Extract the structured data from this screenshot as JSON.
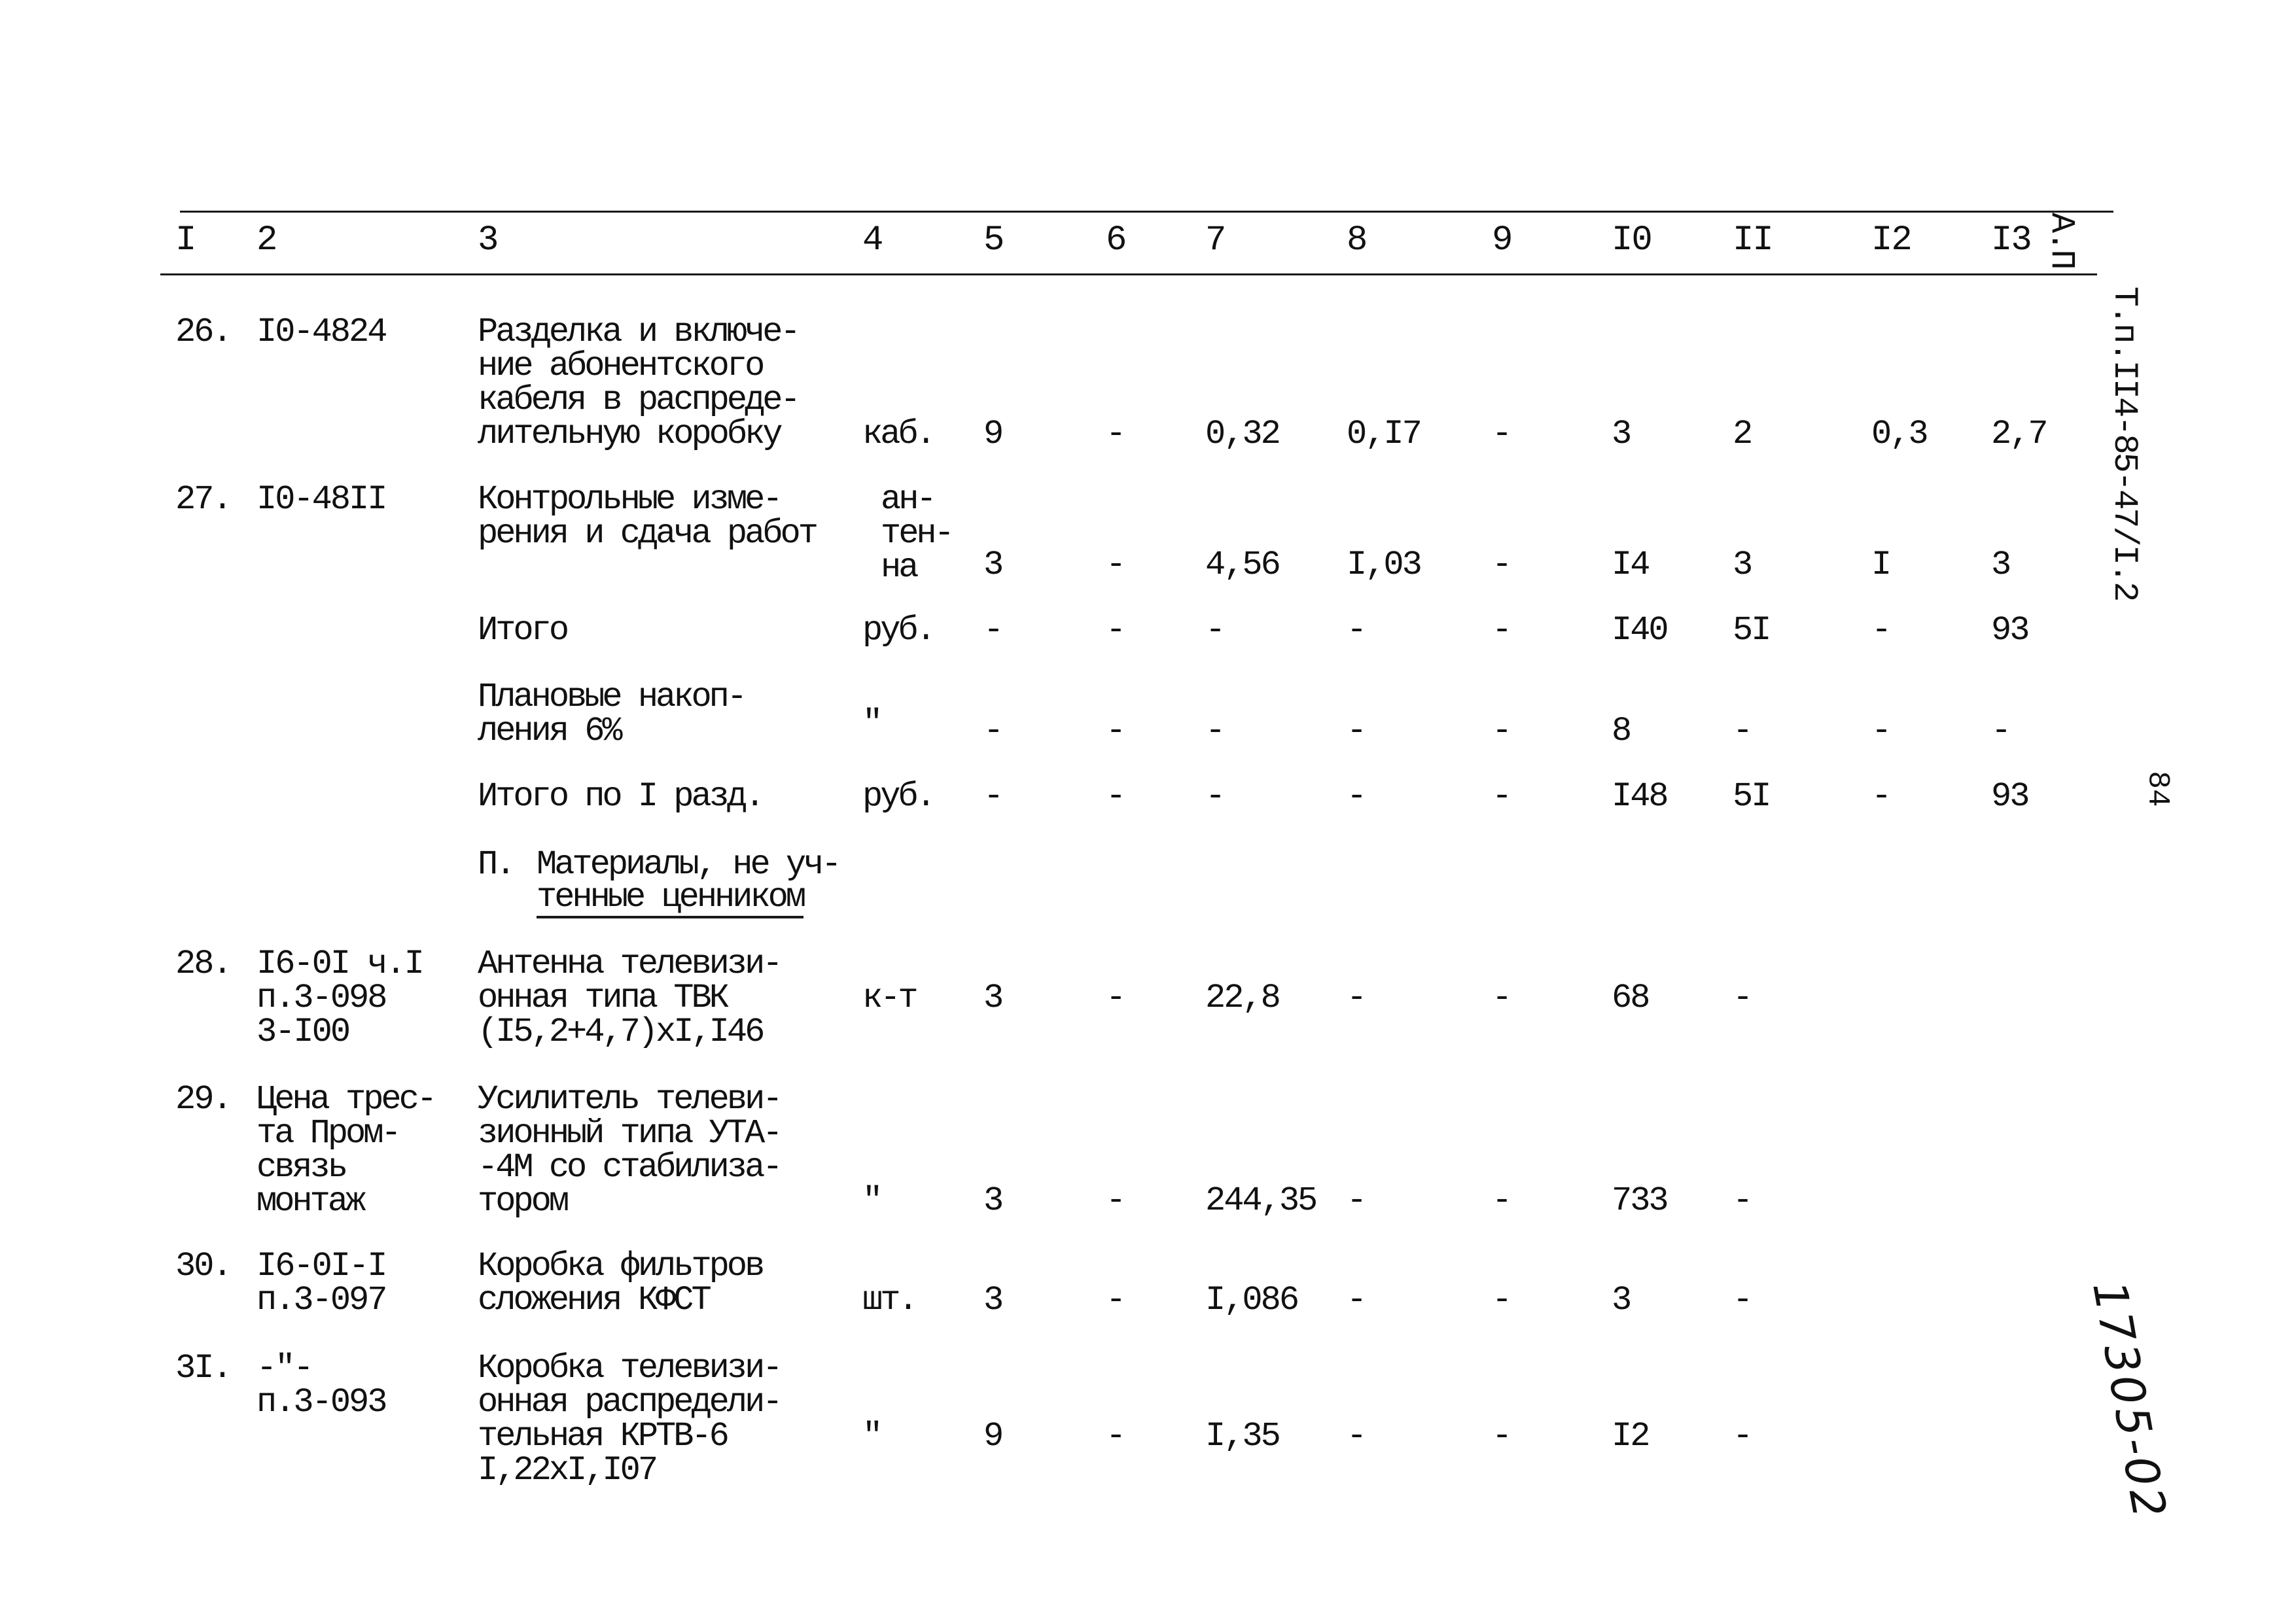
{
  "side_stamp": {
    "line1": "Т.п.II4-85-47/I.2",
    "line2": "А.П"
  },
  "page_number": "84",
  "handwritten_note": "17305-02",
  "header": [
    "I",
    "2",
    "3",
    "4",
    "5",
    "6",
    "7",
    "8",
    "9",
    "I0",
    "II",
    "I2",
    "I3"
  ],
  "rows": [
    {
      "c1": "26.",
      "c2": "I0-4824",
      "c3": "Разделка и включе-\nние абонентского\nкабеля в распреде-\nлительную коробку",
      "c4": "каб.",
      "c5": "9",
      "c6": "-",
      "c7": "0,32",
      "c8": "0,I7",
      "c9": "-",
      "c10": "3",
      "c11": "2",
      "c12": "0,3",
      "c13": "2,7"
    },
    {
      "c1": "27.",
      "c2": "I0-48II",
      "c3": "Контрольные изме-\nрения и сдача работ",
      "c4": "ан-\nтен-\nна",
      "c5": "3",
      "c6": "-",
      "c7": "4,56",
      "c8": "I,03",
      "c9": "-",
      "c10": "I4",
      "c11": "3",
      "c12": "I",
      "c13": "3"
    },
    {
      "c3": "Итого",
      "c4": "руб.",
      "c5": "-",
      "c6": "-",
      "c7": "-",
      "c8": "-",
      "c9": "-",
      "c10": "I40",
      "c11": "5I",
      "c12": "-",
      "c13": "93"
    },
    {
      "c3": "Плановые накоп-\nления 6%",
      "c4": "\"",
      "c5": "-",
      "c6": "-",
      "c7": "-",
      "c8": "-",
      "c9": "-",
      "c10": "8",
      "c11": "-",
      "c12": "-",
      "c13": "-"
    },
    {
      "c3": "Итого по I разд.",
      "c4": "руб.",
      "c5": "-",
      "c6": "-",
      "c7": "-",
      "c8": "-",
      "c9": "-",
      "c10": "I48",
      "c11": "5I",
      "c12": "-",
      "c13": "93"
    },
    {
      "section_prefix": "П. ",
      "section_line1": "Материалы, не уч-",
      "section_line2": "тенные ценником"
    },
    {
      "c1": "28.",
      "c2": "I6-0I ч.I\nп.3-098\n3-I00",
      "c3": "Антенна телевизи-\nонная типа ТВК\n(I5,2+4,7)xI,I46",
      "c4": "к-т",
      "c5": "3",
      "c6": "-",
      "c7": "22,8",
      "c8": "-",
      "c9": "-",
      "c10": "68",
      "c11": "-"
    },
    {
      "c1": "29.",
      "c2": "Цена трес-\nта Пром-\nсвязь\nмонтаж",
      "c3": "Усилитель телеви-\nзионный типа УТА-\n-4М со стабилиза-\nтором",
      "c4": "\"",
      "c5": "3",
      "c6": "-",
      "c7": "244,35",
      "c8": "-",
      "c9": "-",
      "c10": "733",
      "c11": "-"
    },
    {
      "c1": "30.",
      "c2": "I6-0I-I\nп.3-097",
      "c3": "Коробка фильтров\nсложения КФСТ",
      "c4": "шт.",
      "c5": "3",
      "c6": "-",
      "c7": "I,086",
      "c8": "-",
      "c9": "-",
      "c10": "3",
      "c11": "-"
    },
    {
      "c1": "3I.",
      "c2": "-\"-\nп.3-093",
      "c3": "Коробка телевизи-\nонная распредели-\nтельная КРТВ-6\nI,22xI,I07",
      "c4": "\"",
      "c5": "9",
      "c6": "-",
      "c7": "I,35",
      "c8": "-",
      "c9": "-",
      "c10": "I2",
      "c11": "-"
    }
  ]
}
